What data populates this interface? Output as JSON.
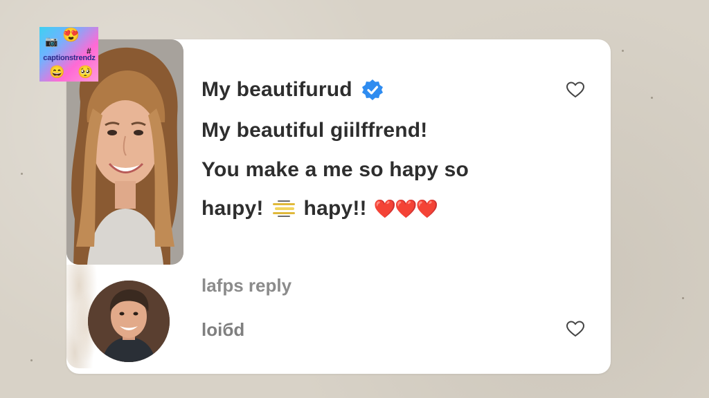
{
  "logo": {
    "text": "captionstrendz",
    "emoji_top": "😍",
    "emoji_left": "📷",
    "emoji_bottom_left": "😄",
    "emoji_bottom_right": "🥺",
    "hash": "#"
  },
  "post": {
    "title": "My beautifurud",
    "line2": "My beautiful giilffrend!",
    "line3": "You make a me so hapy so",
    "line4_prefix": "haıpy!",
    "line4_suffix": "hapy!!",
    "hearts": "❤️❤️❤️"
  },
  "comment": {
    "reply_label": "lafps  reply",
    "username": "loiбd"
  },
  "icons": {
    "verified": "verified-badge-icon",
    "like_post": "heart-outline-icon",
    "like_comment": "heart-outline-icon",
    "sparkle_emoji": "sparkle-lines-emoji"
  },
  "colors": {
    "verified_blue": "#2f8cf0",
    "text_dark": "#2e2e2e",
    "text_muted": "#8b8b8b",
    "heart_red": "#e62a3a"
  }
}
